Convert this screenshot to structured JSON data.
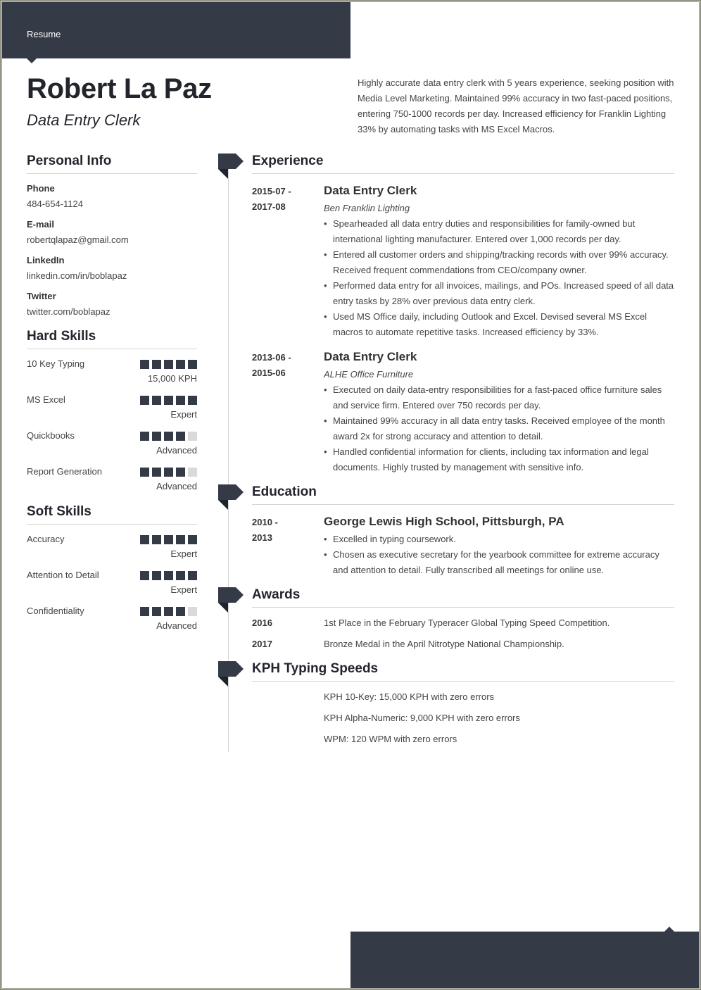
{
  "header": {
    "doc_label": "Resume",
    "name": "Robert La Paz",
    "title": "Data Entry Clerk",
    "summary": "Highly accurate data entry clerk with 5 years experience, seeking position with Media Level Marketing. Maintained 99% accuracy in two fast-paced positions, entering 750-1000 records per day. Increased efficiency for Franklin Lighting 33% by automating tasks with MS Excel Macros."
  },
  "personal_info": {
    "heading": "Personal Info",
    "items": [
      {
        "label": "Phone",
        "value": "484-654-1124"
      },
      {
        "label": "E-mail",
        "value": "robertqlapaz@gmail.com"
      },
      {
        "label": "LinkedIn",
        "value": "linkedin.com/in/boblapaz"
      },
      {
        "label": "Twitter",
        "value": "twitter.com/boblapaz"
      }
    ]
  },
  "hard_skills": {
    "heading": "Hard Skills",
    "items": [
      {
        "name": "10 Key Typing",
        "level": "15,000 KPH",
        "rating": 5,
        "max": 5
      },
      {
        "name": "MS Excel",
        "level": "Expert",
        "rating": 5,
        "max": 5
      },
      {
        "name": "Quickbooks",
        "level": "Advanced",
        "rating": 4,
        "max": 5
      },
      {
        "name": "Report Generation",
        "level": "Advanced",
        "rating": 4,
        "max": 5
      }
    ]
  },
  "soft_skills": {
    "heading": "Soft Skills",
    "items": [
      {
        "name": "Accuracy",
        "level": "Expert",
        "rating": 5,
        "max": 5
      },
      {
        "name": "Attention to Detail",
        "level": "Expert",
        "rating": 5,
        "max": 5
      },
      {
        "name": "Confidentiality",
        "level": "Advanced",
        "rating": 4,
        "max": 5
      }
    ]
  },
  "experience": {
    "heading": "Experience",
    "entries": [
      {
        "date_start": "2015-07 -",
        "date_end": "2017-08",
        "title": "Data Entry Clerk",
        "company": "Ben Franklin Lighting",
        "bullets": [
          "Spearheaded all data entry duties and responsibilities for family-owned but international lighting manufacturer. Entered over 1,000 records per day.",
          "Entered all customer orders and shipping/tracking records with over 99% accuracy. Received frequent commendations from CEO/company owner.",
          "Performed data entry for all invoices, mailings, and POs. Increased speed of all data entry tasks by 28% over previous data entry clerk.",
          "Used MS Office daily, including Outlook and Excel. Devised several MS Excel macros to automate repetitive tasks. Increased efficiency by 33%."
        ]
      },
      {
        "date_start": "2013-06 -",
        "date_end": "2015-06",
        "title": "Data Entry Clerk",
        "company": "ALHE Office Furniture",
        "bullets": [
          "Executed on daily data-entry responsibilities for a fast-paced office furniture sales and service firm. Entered over 750 records per day.",
          "Maintained 99% accuracy in all data entry tasks. Received employee of the month award 2x for strong accuracy and attention to detail.",
          "Handled confidential information for clients, including tax information and legal documents. Highly trusted by management with sensitive info."
        ]
      }
    ]
  },
  "education": {
    "heading": "Education",
    "entries": [
      {
        "date_start": "2010 -",
        "date_end": "2013",
        "title": "George Lewis High School, Pittsburgh, PA",
        "bullets": [
          "Excelled in typing coursework.",
          "Chosen as executive secretary for the yearbook committee for extreme accuracy and attention to detail. Fully transcribed all meetings for online use."
        ]
      }
    ]
  },
  "awards": {
    "heading": "Awards",
    "items": [
      {
        "year": "2016",
        "text": "1st Place in the February Typeracer Global Typing Speed Competition."
      },
      {
        "year": "2017",
        "text": "Bronze Medal in the April Nitrotype National Championship."
      }
    ]
  },
  "typing_speeds": {
    "heading": "KPH Typing Speeds",
    "items": [
      "KPH 10-Key: 15,000 KPH with zero errors",
      "KPH Alpha-Numeric: 9,000 KPH with zero errors",
      "WPM: 120 WPM with zero errors"
    ]
  },
  "colors": {
    "accent": "#343a46",
    "rating_off": "#dadada",
    "divider": "#d6d6d6"
  }
}
